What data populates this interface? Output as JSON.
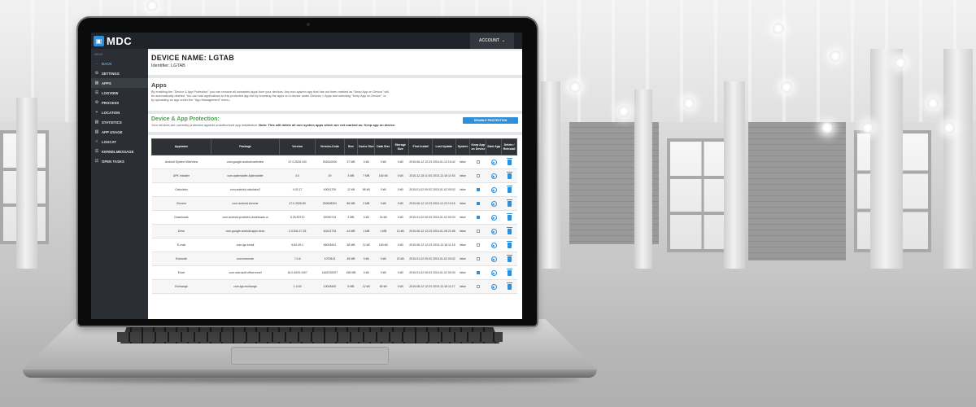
{
  "app": {
    "logo_text": "MDC",
    "account_label": "ACCOUNT",
    "account_caret": "⌄"
  },
  "sidebar": {
    "caption": "MENU",
    "items": [
      {
        "label": "BACK",
        "icon": "←"
      },
      {
        "label": "SETTINGS",
        "icon": "⚙"
      },
      {
        "label": "APPS",
        "icon": "▦"
      },
      {
        "label": "LOGVIEW",
        "icon": "☰"
      },
      {
        "label": "PROCESS",
        "icon": "⚙"
      },
      {
        "label": "LOCATION",
        "icon": "⌖"
      },
      {
        "label": "STATISTICS",
        "icon": "▤"
      },
      {
        "label": "APP USAGE",
        "icon": "▥"
      },
      {
        "label": "LOGCAT",
        "icon": "≡"
      },
      {
        "label": "KERNELMESSAGE",
        "icon": "☰"
      },
      {
        "label": "OPEN TASKS",
        "icon": "☑"
      }
    ]
  },
  "device": {
    "title": "DEVICE NAME: LGTAB",
    "identifier": "Identifier: LGTAB"
  },
  "apps_section": {
    "title": "Apps",
    "description": "By enabling the \"Device & App Protection\" you can remove all unwanted apps from your devices. Any non-system app that has not been marked as \"Keep App on Device\" will be automatically deleted. You can add applications to this protected app list by browsing the apps on a device under Devices > Apps and selecting \"Keep App on Device\", or by uploading an app under the \"App Management\" menu."
  },
  "protection": {
    "title": "Device & App Protection:",
    "desc_plain": "Your devices are currently protected against unauthorized app installation. ",
    "desc_bold": "Note: This will delete all non system apps which are not marked as: Keep app on device.",
    "button_label": "DISABLE PROTECTION"
  },
  "table": {
    "headers": [
      "Appname",
      "Package",
      "Version",
      "Version-Code",
      "Size",
      "Cache Size",
      "Data Size",
      "Storage Size",
      "First Install",
      "Last Update",
      "System",
      "Keep App on Device",
      "Start App",
      "Delete / Reinstall"
    ],
    "rows": [
      {
        "name": "Android System WebView",
        "pkg": "com.google.android.webview",
        "ver": "47.0.2526.100",
        "code": "252610000",
        "size": "37 MB",
        "cache": "0 kB",
        "data": "0 kB",
        "storage": "0 kB",
        "first": "2015-06-12 12:23",
        "last": "2016-01-13 15:42",
        "system": "false",
        "keep": false
      },
      {
        "name": "APK Installer",
        "pkg": "com.apkinstaller.ApkInstaller",
        "ver": "4.0",
        "code": "29",
        "size": "3 MB",
        "cache": "7 MB",
        "data": "160 kB",
        "storage": "0 kB",
        "first": "2015-12-18 11:53",
        "last": "2015-12-18 11:53",
        "system": "false",
        "keep": false
      },
      {
        "name": "Calculator",
        "pkg": "com.android.calculator2",
        "ver": "4.02.17",
        "code": "40001700",
        "size": "12 kB",
        "cache": "56 kB",
        "data": "0 kB",
        "storage": "0 kB",
        "first": "2015-01-02 00:02",
        "last": "2015-01-02 00:02",
        "system": "false",
        "keep": true
      },
      {
        "name": "Chrome",
        "pkg": "com.android.chrome",
        "ver": "47.0.2526.83",
        "code": "252608301",
        "size": "86 MB",
        "cache": "2 MB",
        "data": "0 kB",
        "storage": "0 kB",
        "first": "2015-06-12 12:23",
        "last": "2015-12-23 19:15",
        "system": "false",
        "keep": true
      },
      {
        "name": "Downloads",
        "pkg": "com.android.providers.downloads.ui",
        "ver": "5.25.50710",
        "code": "52050710",
        "size": "2 MB",
        "cache": "0 kB",
        "data": "24 kB",
        "storage": "0 kB",
        "first": "2015-01-02 00:03",
        "last": "2015-01-02 00:03",
        "system": "false",
        "keep": true
      },
      {
        "name": "Drive",
        "pkg": "com.google.android.apps.docs",
        "ver": "2.3.544.17.33",
        "code": "60141733",
        "size": "44 MB",
        "cache": "1 MB",
        "data": "1 MB",
        "storage": "12 kB",
        "first": "2015-06-12 12:23",
        "last": "2016-01-28 21:58",
        "system": "false",
        "keep": false
      },
      {
        "name": "E-mail",
        "pkg": "com.lge.email",
        "ver": "6.60.49.1",
        "code": "66004901",
        "size": "36 MB",
        "cache": "12 kB",
        "data": "160 kB",
        "storage": "0 kB",
        "first": "2015-08-12 12:23",
        "last": "2015-12-18 11:18",
        "system": "false",
        "keep": false
      },
      {
        "name": "Evernote",
        "pkg": "com.evernote",
        "ver": "7.0.6",
        "code": "1070613",
        "size": "48 MB",
        "cache": "0 kB",
        "data": "0 kB",
        "storage": "20 kB",
        "first": "2015-01-02 00:02",
        "last": "2015-01-02 00:02",
        "system": "false",
        "keep": false
      },
      {
        "name": "Excel",
        "pkg": "com.microsoft.office.excel",
        "ver": "16.0.4029.1007",
        "code": "1642292007",
        "size": "158 MB",
        "cache": "0 kB",
        "data": "0 kB",
        "storage": "0 kB",
        "first": "2015-01-02 00:03",
        "last": "2015-01-02 00:03",
        "system": "false",
        "keep": true
      },
      {
        "name": "Exchange",
        "pkg": "com.lge.exchange",
        "ver": "1.0.45",
        "code": "10004500",
        "size": "6 MB",
        "cache": "12 kB",
        "data": "80 kB",
        "storage": "0 kB",
        "first": "2015-08-12 12:23",
        "last": "2015-12-18 11:17",
        "system": "false",
        "keep": false
      }
    ]
  },
  "colors": {
    "accent": "#2f8fd8",
    "green_title": "#49a04a",
    "sidebar_bg": "#2b2f35",
    "topbar_bg": "#20242a"
  },
  "icons": {
    "logo": "device-grid-icon",
    "start_app": "play-icon",
    "delete": "trash-icon"
  }
}
